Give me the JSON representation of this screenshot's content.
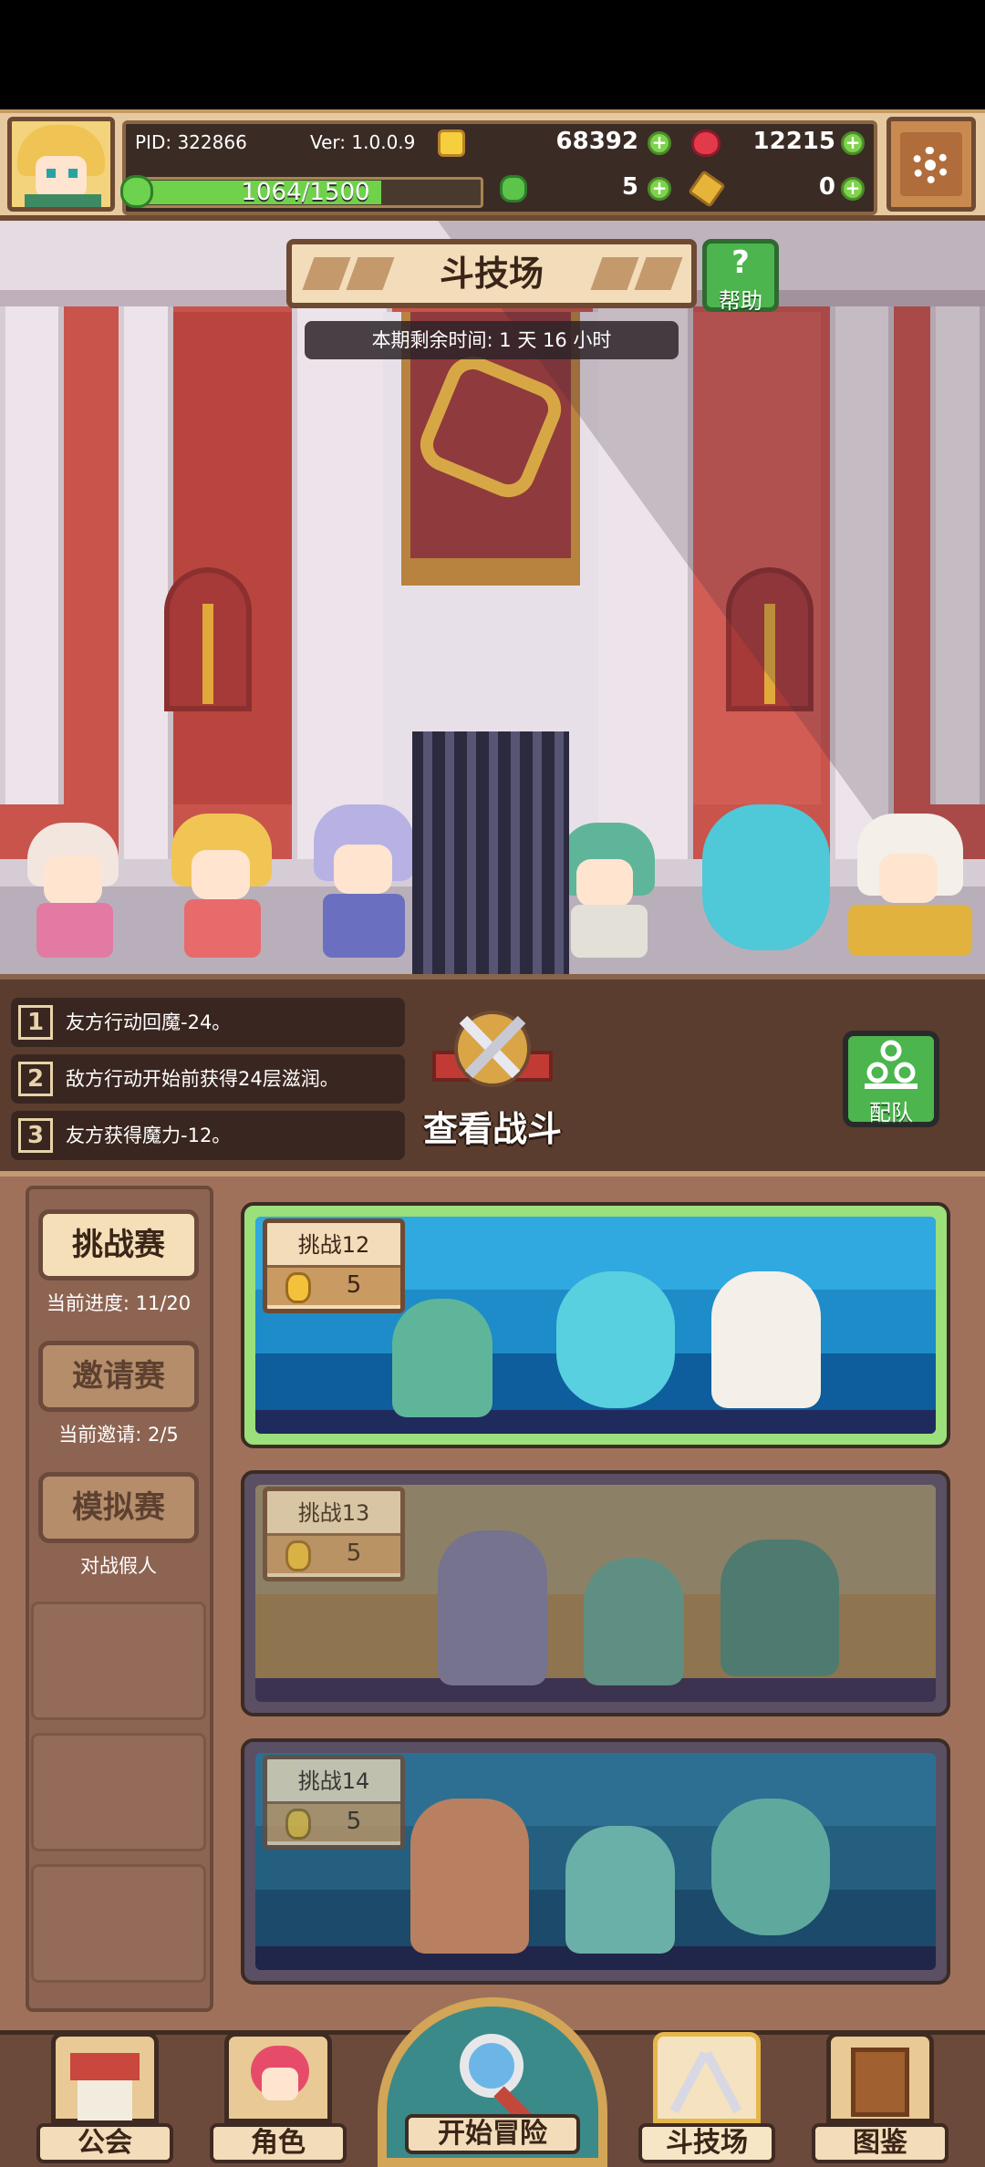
{
  "header": {
    "pid": "PID: 322866",
    "version": "Ver: 1.0.0.9",
    "gold": "68392",
    "gems": "12215",
    "stamina": "1064/1500",
    "stamina_fraction": 0.709,
    "clover_count": "5",
    "key_count": "0",
    "icons": [
      "avatar",
      "coin-icon",
      "ruby-icon",
      "clover-icon",
      "key-icon",
      "plus-icon",
      "gear-icon"
    ]
  },
  "arena": {
    "title": "斗技场",
    "help_label": "帮助",
    "timer": "本期剩余时间: 1 天 16 小时"
  },
  "battle": {
    "effects": [
      {
        "num": "1",
        "text": "友方行动回魔-24。"
      },
      {
        "num": "2",
        "text": "敌方行动开始前获得24层滋润。"
      },
      {
        "num": "3",
        "text": "友方获得魔力-12。"
      }
    ],
    "view_label": "查看战斗",
    "team_label": "配队"
  },
  "modes": {
    "challenge": {
      "label": "挑战赛",
      "sub": "当前进度: 11/20"
    },
    "invite": {
      "label": "邀请赛",
      "sub": "当前邀请: 2/5"
    },
    "mock": {
      "label": "模拟赛",
      "sub": "对战假人"
    }
  },
  "challenges": [
    {
      "title": "挑战12",
      "cost": "5",
      "theme": "ocean",
      "active": true
    },
    {
      "title": "挑战13",
      "cost": "5",
      "theme": "desert",
      "active": false
    },
    {
      "title": "挑战14",
      "cost": "5",
      "theme": "ocean",
      "active": false
    }
  ],
  "nav": {
    "guild": "公会",
    "character": "角色",
    "adventure": "开始冒险",
    "arena": "斗技场",
    "codex": "图鉴"
  },
  "colors": {
    "accent_green": "#4cb54e",
    "wall_red": "#c6524b",
    "panel_brown": "#a0715a",
    "plaque_cream": "#f2dcb9"
  }
}
